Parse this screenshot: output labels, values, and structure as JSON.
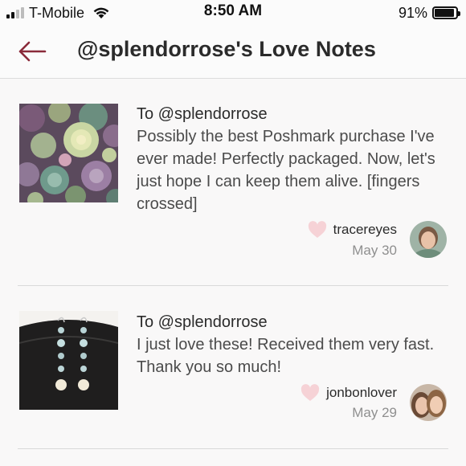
{
  "status_bar": {
    "carrier": "T-Mobile",
    "time": "8:50 AM",
    "battery_percent": "91%",
    "battery_level": 0.91,
    "signal_bars": 2,
    "signal_bars_total": 4
  },
  "nav": {
    "back_icon": "back-arrow-icon",
    "title": "@splendorrose's Love Notes"
  },
  "colors": {
    "accent": "#8a2a3a",
    "heart": "#f6d2d6",
    "divider": "#d9d9d9",
    "date": "#8f8f8f"
  },
  "notes": [
    {
      "to": "To @splendorrose",
      "message": "Possibly the best Poshmark purchase I've ever made! Perfectly packaged. Now, let's just hope I can keep them alive. [fingers crossed]",
      "author": "tracereyes",
      "date": "May 30"
    },
    {
      "to": "To @splendorrose",
      "message": "I just love these! Received them very fast. Thank you so much!",
      "author": "jonbonlover",
      "date": "May 29"
    }
  ]
}
